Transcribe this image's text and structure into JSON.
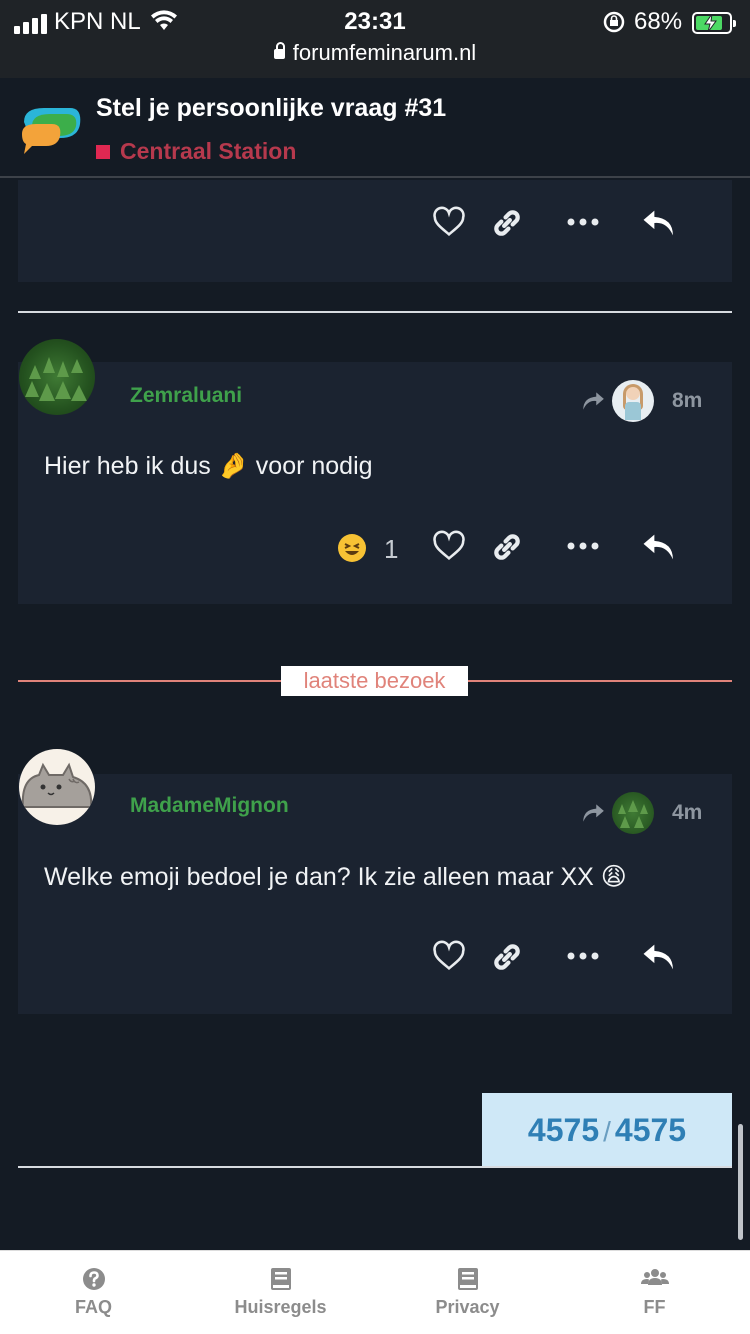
{
  "status_bar": {
    "carrier": "KPN NL",
    "time": "23:31",
    "battery": "68%",
    "url": "forumfeminarum.nl"
  },
  "topic": {
    "title": "Stel je persoonlijke vraag #31",
    "category": "Centraal Station",
    "category_color": "#e02852"
  },
  "posts": [
    {
      "username": "Zemraluani",
      "time": "8m",
      "text": "Hier heb ik dus",
      "emoji": "🤌",
      "text_after": "voor nodig",
      "reaction_count": "1",
      "reaction_icon": "laughing-emoji"
    },
    {
      "username": "MadameMignon",
      "time": "4m",
      "text": "Welke emoji bedoel je dan? Ik zie alleen maar XX",
      "emoji": "😩"
    }
  ],
  "last_visit_label": "laatste bezoek",
  "progress": {
    "current": "4575",
    "separator": "/",
    "total": "4575"
  },
  "bottom_nav": [
    {
      "label": "FAQ",
      "icon": "question-circle-icon"
    },
    {
      "label": "Huisregels",
      "icon": "book-icon"
    },
    {
      "label": "Privacy",
      "icon": "book-icon"
    },
    {
      "label": "FF",
      "icon": "users-icon"
    }
  ],
  "colors": {
    "background": "#141b24",
    "username": "#3fa14b",
    "last_visit": "#e0837a",
    "counter_bg": "#cfe8f7",
    "counter_text": "#2f7fb5"
  }
}
